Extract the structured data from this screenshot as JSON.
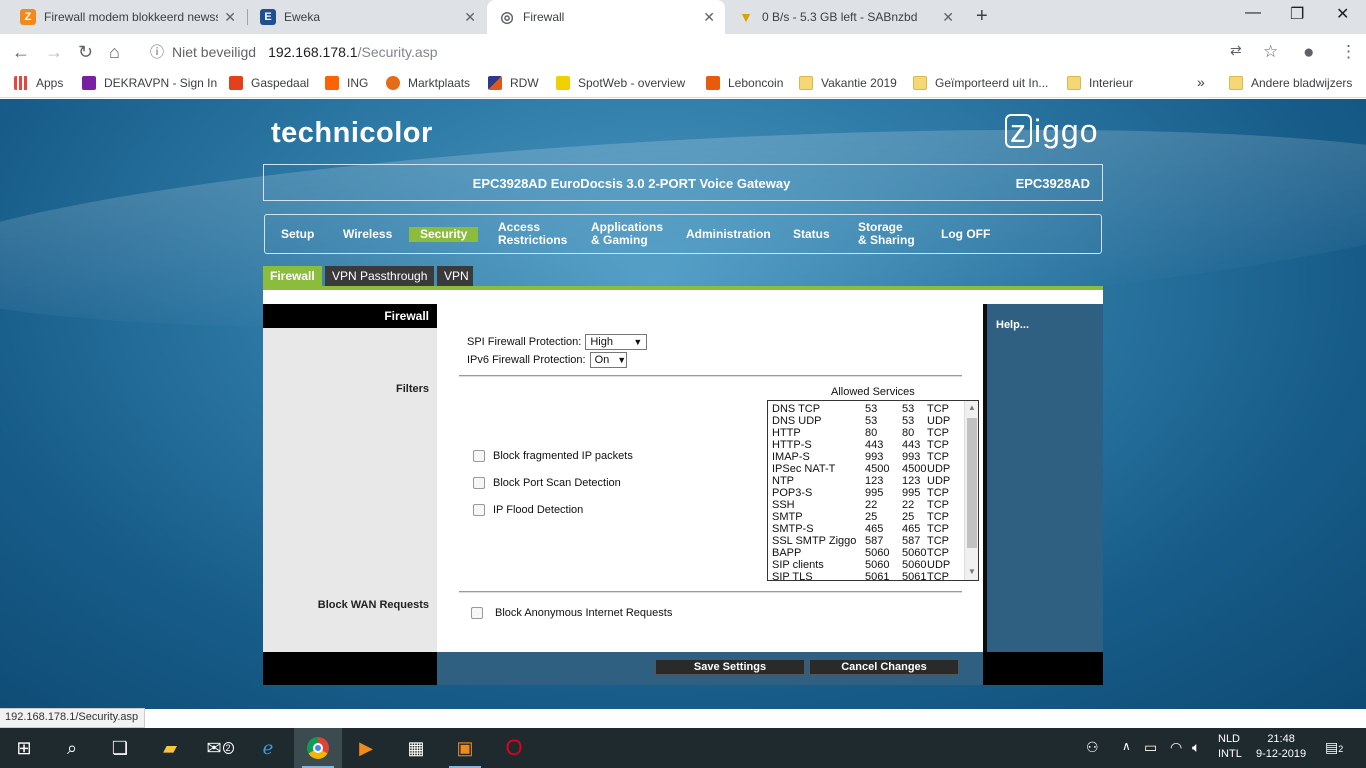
{
  "browser": {
    "tabs": [
      {
        "title": "Firewall modem blokkeerd newss",
        "icon": "zyxel-icon",
        "color": "#f08a1c",
        "glyph": "Z"
      },
      {
        "title": "Eweka",
        "icon": "eweka-icon",
        "color": "#1f4f8f",
        "glyph": "E"
      },
      {
        "title": "Firewall",
        "icon": "globe-icon",
        "color": "#ffffff",
        "glyph": "◎"
      },
      {
        "title": "0 B/s - 5.3 GB left - SABnzbd",
        "icon": "sabnzbd-icon",
        "color": "#f3c21b",
        "glyph": "▼"
      }
    ],
    "address": {
      "security": "Niet beveiligd",
      "host": "192.168.178.1",
      "path": "/Security.asp"
    },
    "bookmarks": [
      {
        "label": "Apps",
        "icon": "apps-grid-icon",
        "color": "#e8453c"
      },
      {
        "label": "DEKRAVPN - Sign In",
        "icon": "dekra-icon",
        "color": "#7a1fa2"
      },
      {
        "label": "Gaspedaal",
        "icon": "gaspedaal-icon",
        "color": "#e3401c"
      },
      {
        "label": "ING",
        "icon": "ing-icon",
        "color": "#ff6200"
      },
      {
        "label": "Marktplaats",
        "icon": "marktplaats-icon",
        "color": "#e56b18"
      },
      {
        "label": "RDW",
        "icon": "rdw-icon",
        "color": "#2d3a8c"
      },
      {
        "label": "SpotWeb - overview",
        "icon": "spotweb-icon",
        "color": "#f0d000"
      },
      {
        "label": "Leboncoin",
        "icon": "leboncoin-icon",
        "color": "#ea5a0c"
      },
      {
        "label": "Vakantie 2019",
        "icon": "folder-icon",
        "color": "#f6d776"
      },
      {
        "label": "Geïmporteerd uit In...",
        "icon": "folder-icon",
        "color": "#f6d776"
      },
      {
        "label": "Interieur",
        "icon": "folder-icon",
        "color": "#f6d776"
      },
      {
        "label": "Andere bladwijzers",
        "icon": "folder-icon",
        "color": "#f6d776"
      }
    ]
  },
  "router": {
    "brand_left": "technicolor",
    "brand_right": "ziggo",
    "model_title": "EPC3928AD EuroDocsis 3.0 2-PORT Voice Gateway",
    "model_short": "EPC3928AD",
    "menu": [
      {
        "label": "Setup"
      },
      {
        "label": "Wireless"
      },
      {
        "label": "Security"
      },
      {
        "label1": "Access",
        "label2": "Restrictions"
      },
      {
        "label1": "Applications",
        "label2": "& Gaming"
      },
      {
        "label": "Administration"
      },
      {
        "label": "Status"
      },
      {
        "label1": "Storage",
        "label2": "& Sharing"
      },
      {
        "label": "Log OFF"
      }
    ],
    "subtabs": [
      "Firewall",
      "VPN Passthrough",
      "VPN"
    ],
    "section_title": "Firewall",
    "labels": {
      "filters": "Filters",
      "block_wan": "Block WAN Requests",
      "help": "Help..."
    },
    "spi": {
      "label": "SPI Firewall Protection:",
      "value": "High"
    },
    "ipv6": {
      "label": "IPv6 Firewall Protection:",
      "value": "On"
    },
    "checks": [
      {
        "label": "Block fragmented IP packets",
        "checked": false
      },
      {
        "label": "Block Port Scan Detection",
        "checked": false
      },
      {
        "label": "IP Flood Detection",
        "checked": false
      }
    ],
    "anon": {
      "label": "Block Anonymous Internet Requests",
      "checked": false
    },
    "services_title": "Allowed Services",
    "services": [
      [
        "DNS TCP",
        "53",
        "53",
        "TCP"
      ],
      [
        "DNS UDP",
        "53",
        "53",
        "UDP"
      ],
      [
        "HTTP",
        "80",
        "80",
        "TCP"
      ],
      [
        "HTTP-S",
        "443",
        "443",
        "TCP"
      ],
      [
        "IMAP-S",
        "993",
        "993",
        "TCP"
      ],
      [
        "IPSec NAT-T",
        "4500",
        "4500",
        "UDP"
      ],
      [
        "NTP",
        "123",
        "123",
        "UDP"
      ],
      [
        "POP3-S",
        "995",
        "995",
        "TCP"
      ],
      [
        "SSH",
        "22",
        "22",
        "TCP"
      ],
      [
        "SMTP",
        "25",
        "25",
        "TCP"
      ],
      [
        "SMTP-S",
        "465",
        "465",
        "TCP"
      ],
      [
        "SSL SMTP Ziggo",
        "587",
        "587",
        "TCP"
      ],
      [
        "BAPP",
        "5060",
        "5060",
        "TCP"
      ],
      [
        "SIP clients",
        "5060",
        "5060",
        "UDP"
      ],
      [
        "SIP TLS",
        "5061",
        "5061",
        "TCP"
      ]
    ],
    "buttons": {
      "save": "Save Settings",
      "cancel": "Cancel Changes"
    }
  },
  "status_url": "192.168.178.1/Security.asp",
  "taskbar": {
    "lang1": "NLD",
    "lang2": "INTL",
    "time": "21:48",
    "date": "9-12-2019",
    "mail_badge": "2",
    "notif_badge": "2"
  }
}
